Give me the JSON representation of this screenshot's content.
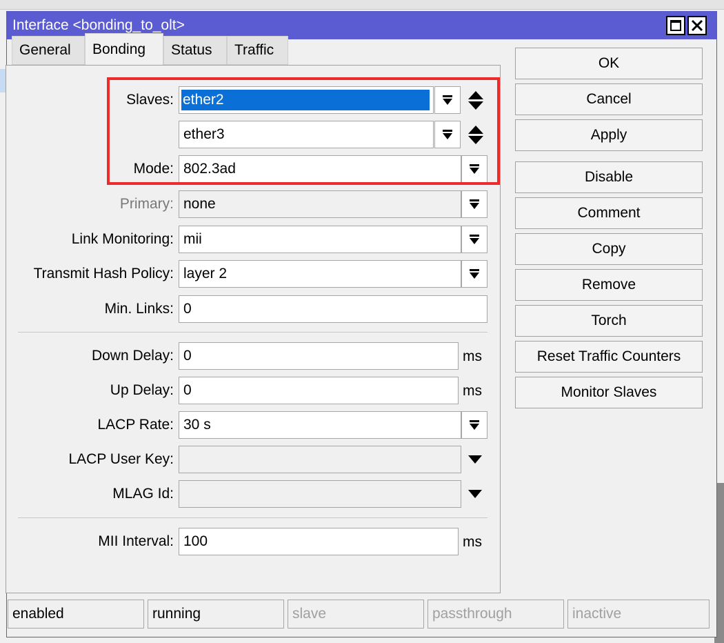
{
  "window": {
    "title": "Interface <bonding_to_olt>"
  },
  "tabs": [
    {
      "label": "General"
    },
    {
      "label": "Bonding",
      "active": true
    },
    {
      "label": "Status"
    },
    {
      "label": "Traffic"
    }
  ],
  "form": {
    "slaves_label": "Slaves:",
    "slave1": "ether2",
    "slave2": "ether3",
    "mode_label": "Mode:",
    "mode": "802.3ad",
    "primary_label": "Primary:",
    "primary": "none",
    "link_monitoring_label": "Link Monitoring:",
    "link_monitoring": "mii",
    "transmit_hash_label": "Transmit Hash Policy:",
    "transmit_hash": "layer 2",
    "min_links_label": "Min. Links:",
    "min_links": "0",
    "down_delay_label": "Down Delay:",
    "down_delay": "0",
    "up_delay_label": "Up Delay:",
    "up_delay": "0",
    "lacp_rate_label": "LACP Rate:",
    "lacp_rate": "30 s",
    "lacp_user_key_label": "LACP User Key:",
    "lacp_user_key": "",
    "mlag_id_label": "MLAG Id:",
    "mlag_id": "",
    "mii_interval_label": "MII Interval:",
    "mii_interval": "100",
    "unit_ms": "ms"
  },
  "buttons": {
    "ok": "OK",
    "cancel": "Cancel",
    "apply": "Apply",
    "disable": "Disable",
    "comment": "Comment",
    "copy": "Copy",
    "remove": "Remove",
    "torch": "Torch",
    "reset_traffic": "Reset Traffic Counters",
    "monitor_slaves": "Monitor Slaves"
  },
  "statusbar": {
    "enabled": "enabled",
    "running": "running",
    "slave": "slave",
    "passthrough": "passthrough",
    "inactive": "inactive"
  },
  "colors": {
    "titlebar": "#5b5bd2",
    "selection": "#0a6fd6",
    "highlight": "#ee2b2b"
  }
}
